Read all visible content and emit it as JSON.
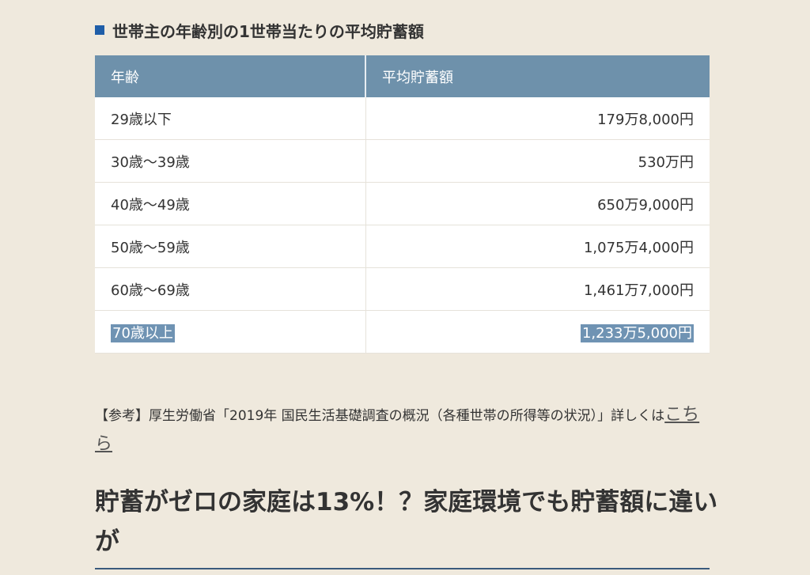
{
  "caption": {
    "text": "世帯主の年齢別の1世帯当たりの平均貯蓄額"
  },
  "table": {
    "headers": [
      "年齢",
      "平均貯蓄額"
    ],
    "rows": [
      {
        "age": "29歳以下",
        "amount": "179万8,000円"
      },
      {
        "age": "30歳～39歳",
        "amount": "530万円"
      },
      {
        "age": "40歳～49歳",
        "amount": "650万9,000円"
      },
      {
        "age": "50歳～59歳",
        "amount": "1,075万4,000円"
      },
      {
        "age": "60歳～69歳",
        "amount": "1,461万7,000円"
      },
      {
        "age": "70歳以上",
        "amount": "1,233万5,000円"
      }
    ]
  },
  "reference": {
    "text": "【参考】厚生労働省「2019年 国民生活基礎調査の概況（各種世帯の所得等の状況）」詳しくは",
    "link_text": "こちら"
  },
  "section": {
    "heading": "貯蓄がゼロの家庭は13%！？家庭環境でも貯蓄額に違いが"
  },
  "colors": {
    "background": "#efe9dd",
    "header": "#6e91ab",
    "selection": "#6f93b3",
    "marker": "#1f5ea8"
  }
}
